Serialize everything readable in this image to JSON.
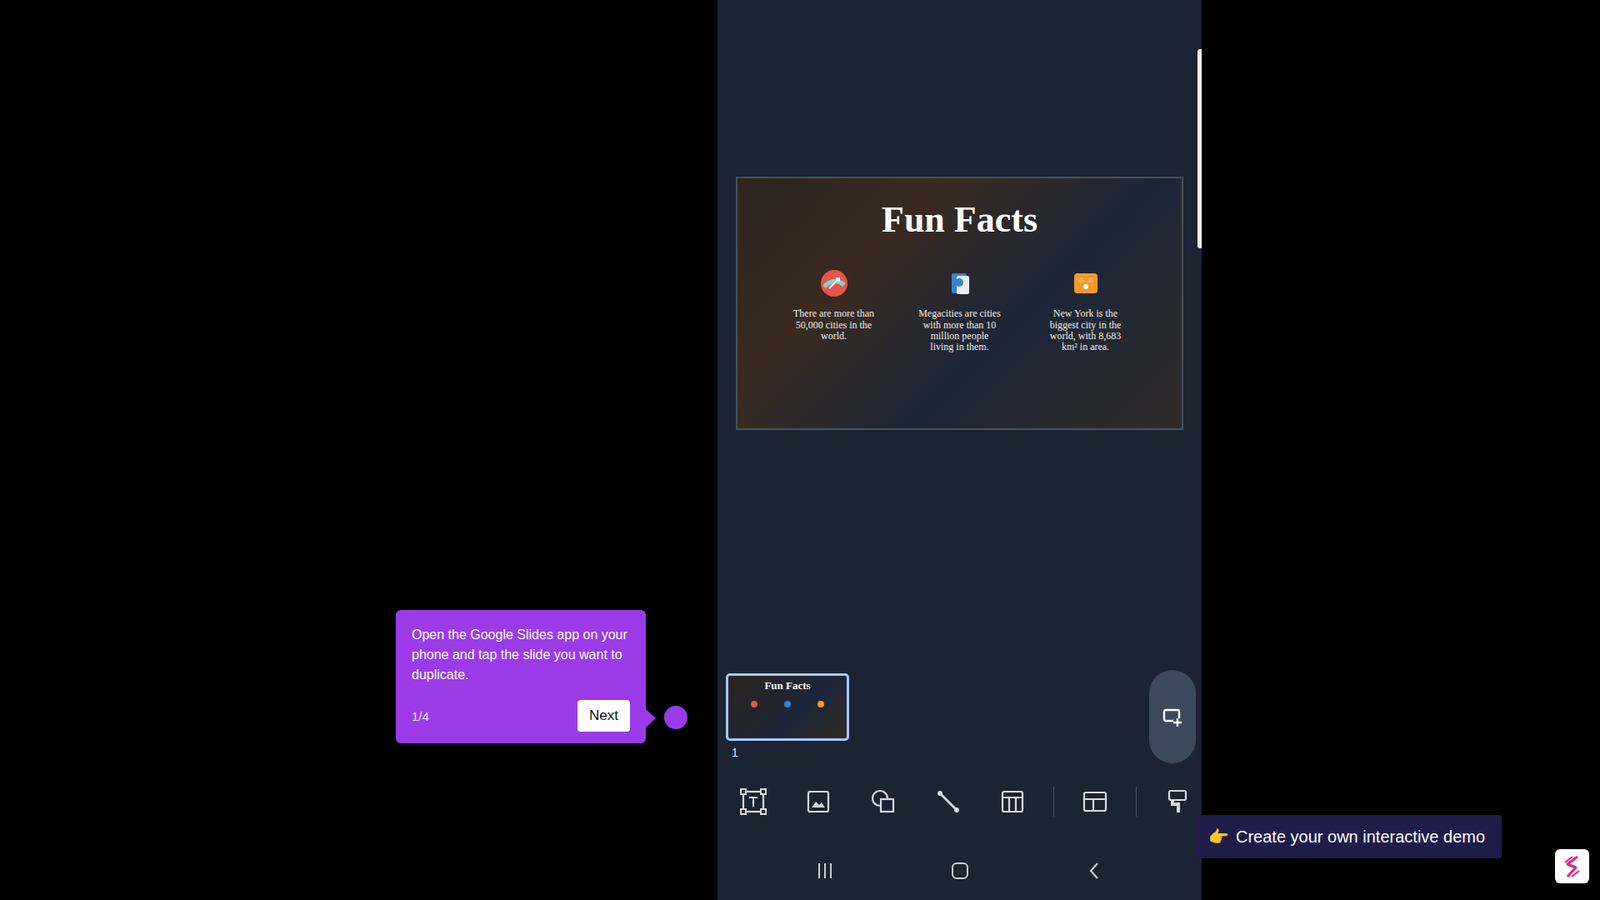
{
  "tooltip": {
    "text": "Open the Google Slides app on your phone and tap the slide you want to duplicate.",
    "step": "1/4",
    "button": "Next"
  },
  "slide": {
    "title": "Fun Facts",
    "facts": [
      "There are more than 50,000 cities in the world.",
      "Megacities are cities with more than 10 million people living in them.",
      "New York is the biggest city in the world, with 8,683 km² in area."
    ]
  },
  "thumbnails": [
    {
      "number": "1",
      "selected": true
    }
  ],
  "cta": {
    "icon": "👉",
    "label": "Create your own interactive demo"
  }
}
